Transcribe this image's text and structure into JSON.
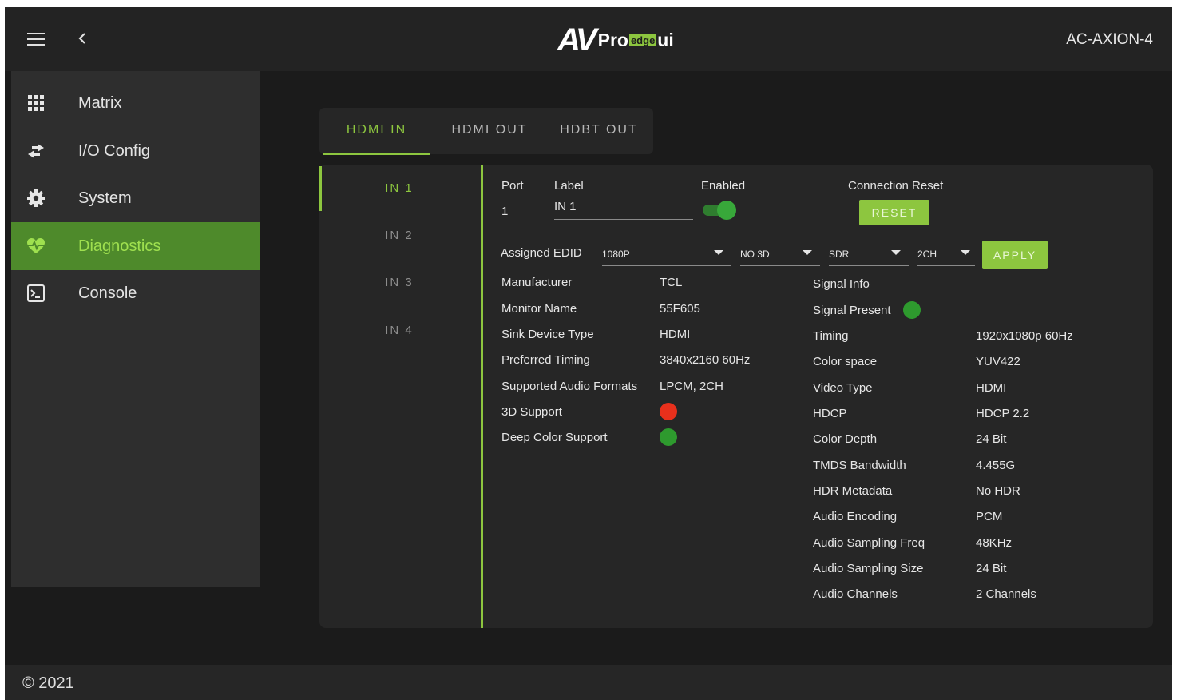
{
  "header": {
    "logo_av": "AV",
    "logo_pro": "Pro",
    "logo_edge": "edge",
    "logo_ui": "ui",
    "model": "AC-AXION-4"
  },
  "sidebar": {
    "items": [
      {
        "label": "Matrix",
        "icon": "grid-icon"
      },
      {
        "label": "I/O Config",
        "icon": "swap-arrows-icon"
      },
      {
        "label": "System",
        "icon": "gear-icon"
      },
      {
        "label": "Diagnostics",
        "icon": "heartbeat-icon",
        "active": true
      },
      {
        "label": "Console",
        "icon": "terminal-icon"
      }
    ]
  },
  "tabs": [
    "HDMI IN",
    "HDMI OUT",
    "HDBT OUT"
  ],
  "inputs": [
    "IN 1",
    "IN 2",
    "IN 3",
    "IN 4"
  ],
  "port_settings": {
    "port_header": "Port",
    "port_value": "1",
    "label_header": "Label",
    "label_value": "IN 1",
    "enabled_header": "Enabled",
    "enabled": true,
    "reset_header": "Connection Reset",
    "reset_button": "RESET"
  },
  "edid": {
    "label": "Assigned EDID",
    "resolution": "1080P",
    "mode_3d": "NO 3D",
    "hdr": "SDR",
    "audio": "2CH",
    "apply_button": "APPLY"
  },
  "sink_info": [
    {
      "label": "Manufacturer",
      "value": "TCL"
    },
    {
      "label": "Monitor Name",
      "value": "55F605"
    },
    {
      "label": "Sink Device Type",
      "value": "HDMI"
    },
    {
      "label": "Preferred Timing",
      "value": "3840x2160 60Hz"
    },
    {
      "label": "Supported Audio Formats",
      "value": "LPCM, 2CH"
    },
    {
      "label": "3D Support",
      "status": "red"
    },
    {
      "label": "Deep Color Support",
      "status": "green"
    }
  ],
  "signal_info": {
    "title": "Signal Info",
    "present_label": "Signal Present",
    "present_status": "green",
    "rows": [
      {
        "label": "Timing",
        "value": "1920x1080p 60Hz"
      },
      {
        "label": "Color space",
        "value": "YUV422"
      },
      {
        "label": "Video Type",
        "value": "HDMI"
      },
      {
        "label": "HDCP",
        "value": "HDCP 2.2"
      },
      {
        "label": "Color Depth",
        "value": "24 Bit"
      },
      {
        "label": "TMDS Bandwidth",
        "value": "4.455G"
      },
      {
        "label": "HDR Metadata",
        "value": "No HDR"
      },
      {
        "label": "Audio Encoding",
        "value": "PCM"
      },
      {
        "label": "Audio Sampling Freq",
        "value": "48KHz"
      },
      {
        "label": "Audio Sampling Size",
        "value": "24 Bit"
      },
      {
        "label": "Audio Channels",
        "value": "2 Channels"
      }
    ]
  },
  "colors": {
    "accent": "#8dc63f",
    "active_nav": "#4e8a2b",
    "status_red": "#e8301c",
    "status_green": "#2e9a2e"
  },
  "footer": {
    "copyright": "© 2021"
  }
}
